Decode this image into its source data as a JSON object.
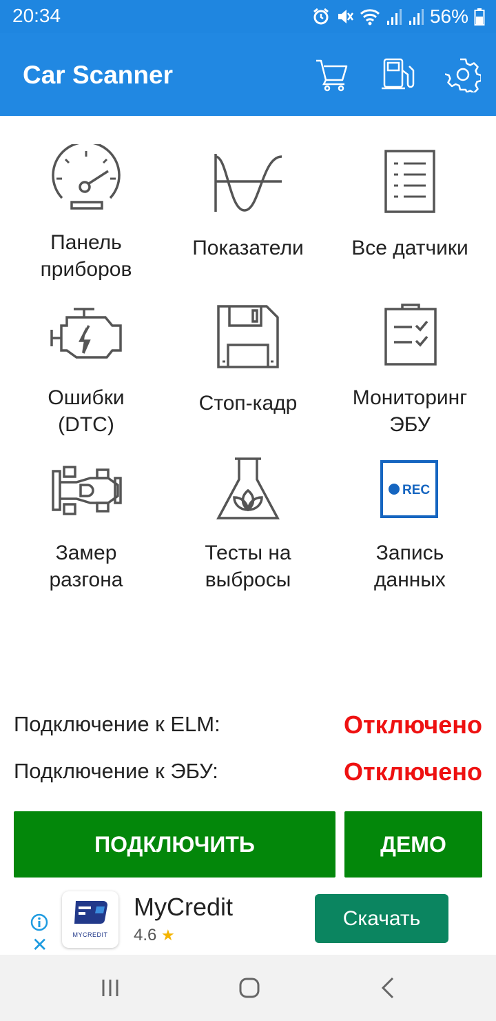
{
  "status_bar": {
    "time": "20:34",
    "battery": "56%",
    "icons": [
      "alarm-icon",
      "mute-icon",
      "wifi-icon",
      "signal-icon",
      "signal-icon",
      "battery-icon"
    ]
  },
  "app_bar": {
    "title": "Car Scanner",
    "actions": [
      "cart-icon",
      "fuel-icon",
      "settings-icon"
    ]
  },
  "grid": [
    {
      "label": "Панель\nприборов",
      "icon": "dashboard-icon"
    },
    {
      "label": "Показатели",
      "icon": "graph-icon"
    },
    {
      "label": "Все датчики",
      "icon": "list-icon"
    },
    {
      "label": "Ошибки\n(DTC)",
      "icon": "engine-icon"
    },
    {
      "label": "Стоп-кадр",
      "icon": "floppy-icon"
    },
    {
      "label": "Мониторинг\nЭБУ",
      "icon": "clipboard-icon"
    },
    {
      "label": "Замер\nразгона",
      "icon": "race-car-icon"
    },
    {
      "label": "Тесты на\nвыбросы",
      "icon": "flask-icon"
    },
    {
      "label": "Запись\nданных",
      "icon": "rec-icon"
    }
  ],
  "rec_text": "REC",
  "connection": {
    "elm_label": "Подключение к ELM:",
    "elm_value": "Отключено",
    "ecu_label": "Подключение к ЭБУ:",
    "ecu_value": "Отключено",
    "status_color": "#ee1111"
  },
  "buttons": {
    "connect": "ПОДКЛЮЧИТЬ",
    "demo": "ДЕМО"
  },
  "ad": {
    "name": "MyCredit",
    "logo_text": "MYCREDIT",
    "rating": "4.6",
    "cta": "Скачать"
  },
  "colors": {
    "accent": "#2188e2",
    "button_green": "#03870a",
    "ad_button": "#0b8560"
  }
}
